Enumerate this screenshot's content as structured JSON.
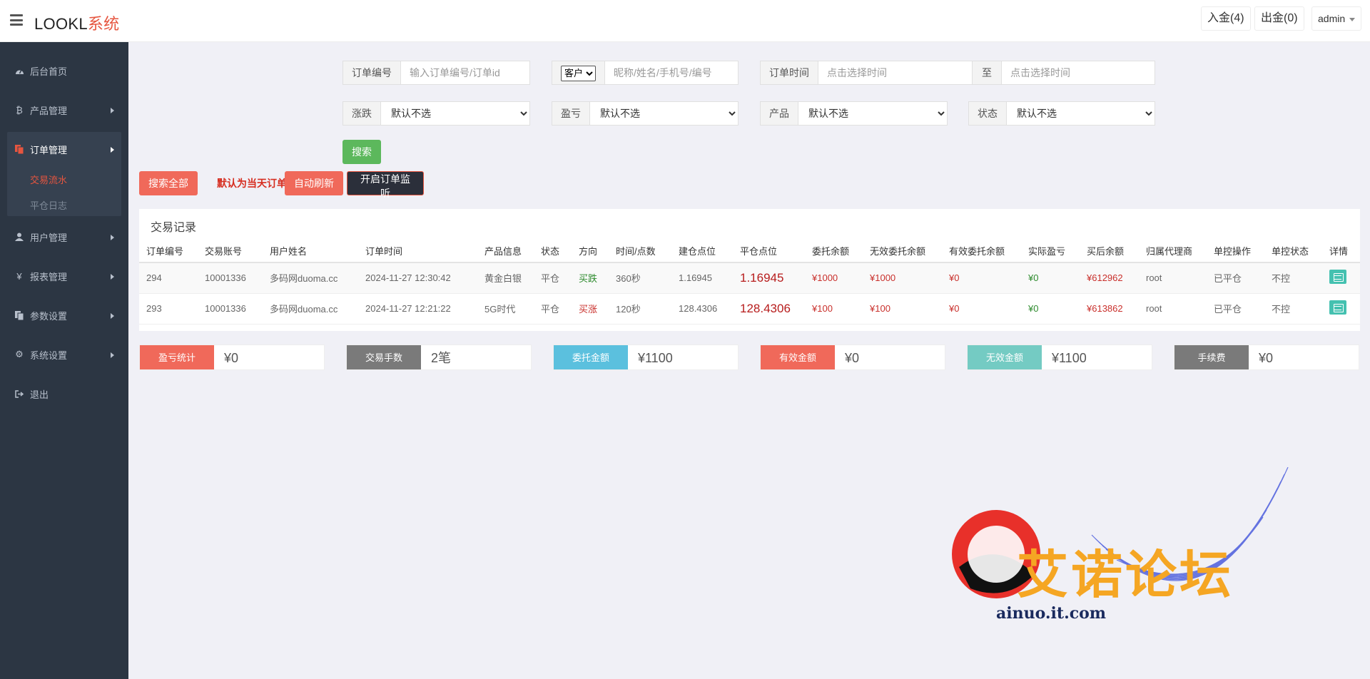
{
  "header": {
    "logo_main": "LOOKL",
    "logo_accent": "系统",
    "deposit": "入金(4)",
    "withdraw": "出金(0)",
    "user": "admin"
  },
  "sidebar": {
    "items": [
      {
        "label": "后台首页",
        "icon": "dashboard-icon"
      },
      {
        "label": "产品管理",
        "icon": "bitcoin-icon"
      },
      {
        "label": "订单管理",
        "icon": "copy-icon"
      },
      {
        "label": "用户管理",
        "icon": "user-icon"
      },
      {
        "label": "报表管理",
        "icon": "yen-icon"
      },
      {
        "label": "参数设置",
        "icon": "copy-icon"
      },
      {
        "label": "系统设置",
        "icon": "gears-icon"
      },
      {
        "label": "退出",
        "icon": "signout-icon"
      }
    ],
    "sub_items": [
      {
        "label": "交易流水"
      },
      {
        "label": "平仓日志"
      }
    ]
  },
  "filters": {
    "order_no_label": "订单编号",
    "order_no_placeholder": "输入订单编号/订单id",
    "customer_select": "客户",
    "customer_placeholder": "昵称/姓名/手机号/编号",
    "order_time_label": "订单时间",
    "time_placeholder": "点击选择时间",
    "to_label": "至",
    "rise_fall_label": "涨跌",
    "profit_label": "盈亏",
    "product_label": "产品",
    "status_label": "状态",
    "default_option": "默认不选",
    "search_button": "搜索"
  },
  "actions": {
    "search_all": "搜索全部",
    "notice": "默认为当天订单",
    "auto_refresh": "自动刷新",
    "monitor": "开启订单监听"
  },
  "table": {
    "title": "交易记录",
    "columns": [
      "订单编号",
      "交易账号",
      "用户姓名",
      "订单时间",
      "产品信息",
      "状态",
      "方向",
      "时间/点数",
      "建仓点位",
      "平仓点位",
      "委托余额",
      "无效委托余额",
      "有效委托余额",
      "实际盈亏",
      "买后余额",
      "归属代理商",
      "单控操作",
      "单控状态",
      "详情"
    ],
    "rows": [
      {
        "id": "294",
        "account": "10001336",
        "name": "多码网duoma.cc",
        "time": "2024-11-27 12:30:42",
        "product": "黄金白银",
        "status": "平仓",
        "direction": "买跌",
        "duration": "360秒",
        "open": "1.16945",
        "close": "1.16945",
        "entrust": "¥1000",
        "invalid": "¥1000",
        "valid": "¥0",
        "pnl": "¥0",
        "balance": "¥612962",
        "agent": "root",
        "ctrl_op": "已平仓",
        "ctrl_status": "不控"
      },
      {
        "id": "293",
        "account": "10001336",
        "name": "多码网duoma.cc",
        "time": "2024-11-27 12:21:22",
        "product": "5G时代",
        "status": "平仓",
        "direction": "买涨",
        "duration": "120秒",
        "open": "128.4306",
        "close": "128.4306",
        "entrust": "¥100",
        "invalid": "¥100",
        "valid": "¥0",
        "pnl": "¥0",
        "balance": "¥613862",
        "agent": "root",
        "ctrl_op": "已平仓",
        "ctrl_status": "不控"
      }
    ]
  },
  "stats": [
    {
      "label": "盈亏统计",
      "value": "¥0",
      "color": "#f0695a"
    },
    {
      "label": "交易手数",
      "value": "2笔",
      "color": "#7a7a7a"
    },
    {
      "label": "委托金额",
      "value": "¥1100",
      "color": "#5bc0de"
    },
    {
      "label": "有效金额",
      "value": "¥0",
      "color": "#f0695a"
    },
    {
      "label": "无效金额",
      "value": "¥1100",
      "color": "#74cbc3"
    },
    {
      "label": "手续费",
      "value": "¥0",
      "color": "#7a7a7a"
    }
  ],
  "watermark": {
    "title": "艾诺论坛",
    "url": "ainuo.it.com"
  }
}
